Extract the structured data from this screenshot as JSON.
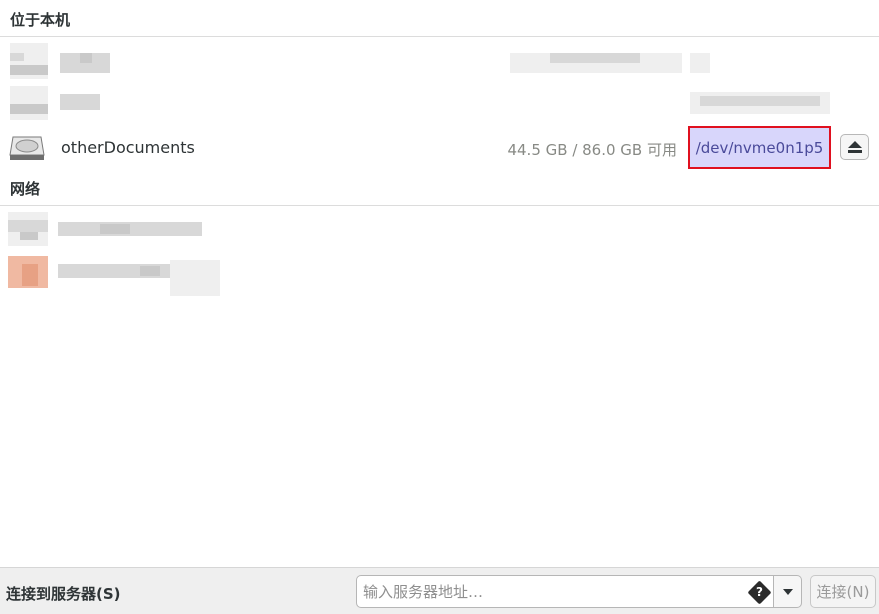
{
  "local_section": {
    "title": "位于本机"
  },
  "network_section": {
    "title": "网络"
  },
  "drive": {
    "name": "otherDocuments",
    "space": "44.5 GB / 86.0 GB 可用",
    "path": "/dev/nvme0n1p5",
    "icon": "drive-icon",
    "eject_icon": "eject-icon"
  },
  "bottom": {
    "connect_label": "连接到服务器(S)",
    "server_placeholder": "输入服务器地址…",
    "help_icon_glyph": "?",
    "connect_button": "连接(N)"
  },
  "colors": {
    "highlight_border": "#e0101f",
    "highlight_bg": "#d8d6fb"
  }
}
